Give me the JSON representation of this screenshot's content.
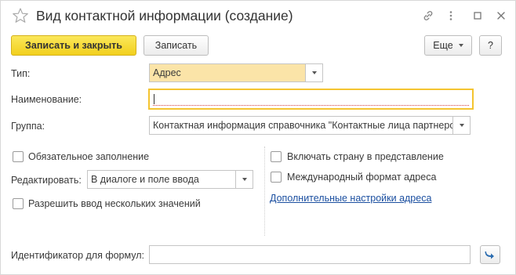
{
  "window": {
    "title": "Вид контактной информации (создание)"
  },
  "toolbar": {
    "save_close_label": "Записать и закрыть",
    "save_label": "Записать",
    "more_label": "Еще",
    "help_label": "?"
  },
  "form": {
    "type": {
      "label": "Тип:",
      "value": "Адрес"
    },
    "name": {
      "label": "Наименование:",
      "value": ""
    },
    "group": {
      "label": "Группа:",
      "value": "Контактная информация справочника \"Контактные лица партнеров\""
    },
    "required_fill": {
      "label": "Обязательное заполнение",
      "checked": false
    },
    "edit_mode": {
      "label": "Редактировать:",
      "value": "В диалоге и поле ввода"
    },
    "allow_multiple": {
      "label": "Разрешить ввод нескольких значений",
      "checked": false
    },
    "include_country": {
      "label": "Включать страну в представление",
      "checked": false
    },
    "intl_format": {
      "label": "Международный формат адреса",
      "checked": false
    },
    "more_settings_link": "Дополнительные настройки адреса",
    "formula_id": {
      "label": "Идентификатор для формул:",
      "value": ""
    }
  },
  "icons": {
    "favorite": "star-icon",
    "link": "link-icon",
    "more": "more-vertical-icon",
    "maximize": "maximize-icon",
    "close": "close-icon",
    "go": "arrow-go-icon"
  },
  "colors": {
    "primary_button": "#f2d01d",
    "type_field_bg": "#fbe4a8",
    "focus_border": "#f4c430",
    "link": "#1b4fa0",
    "go_arrow": "#2b6cb0"
  }
}
